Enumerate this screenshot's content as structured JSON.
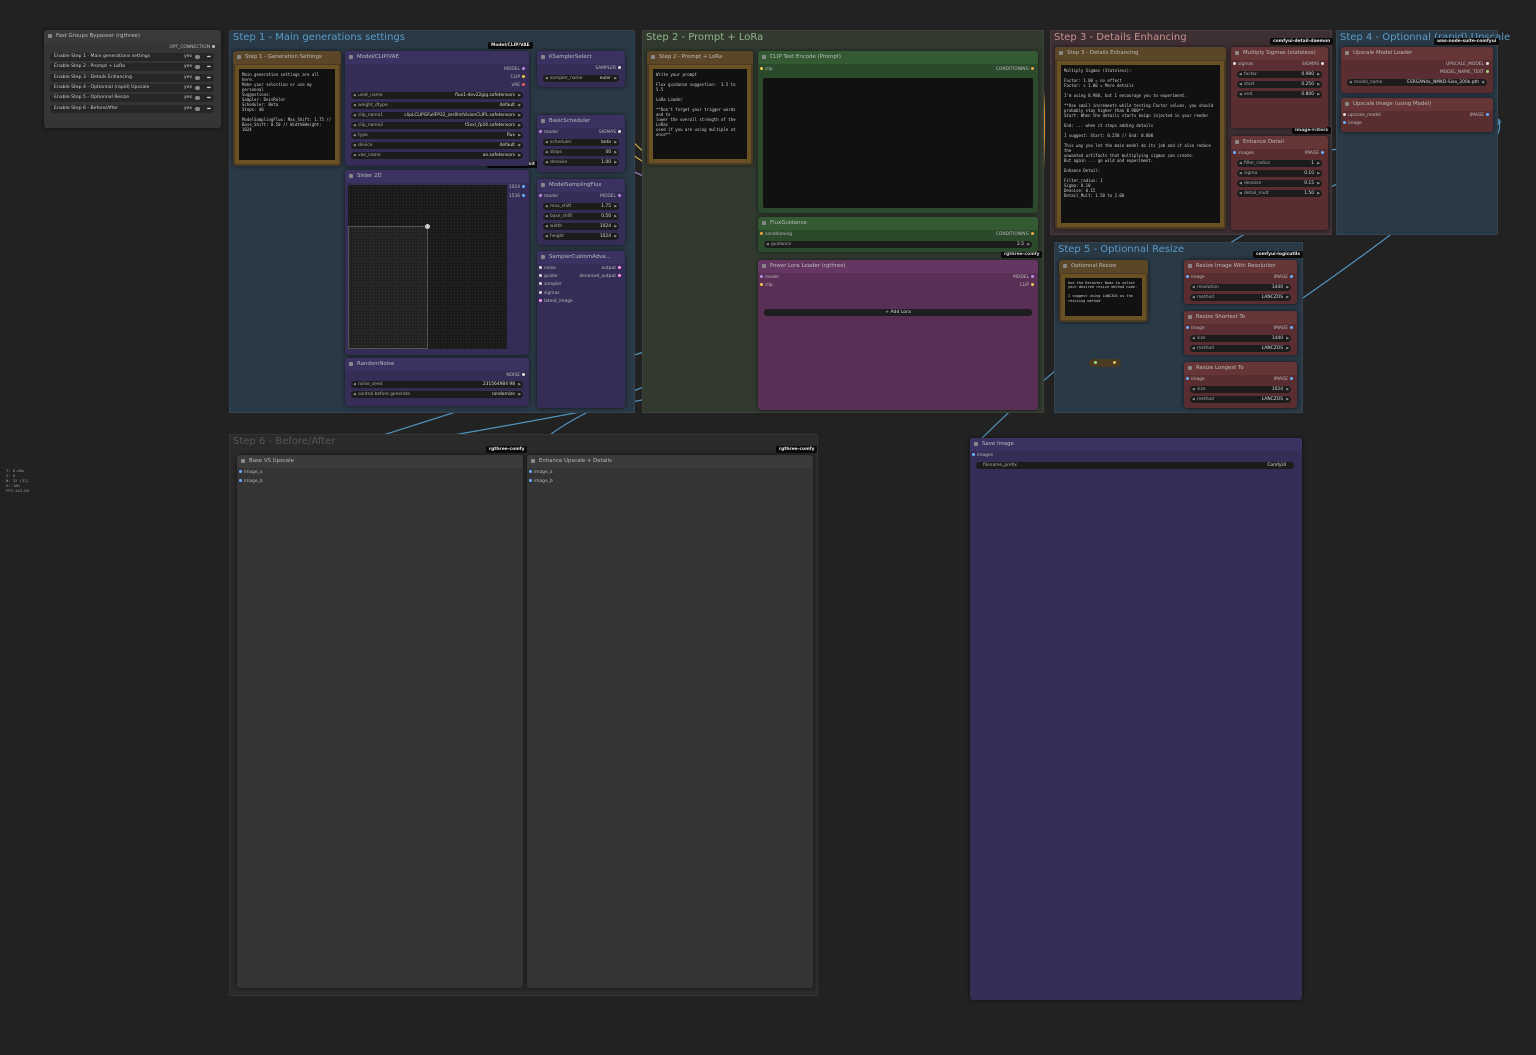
{
  "bypasser": {
    "title": "Fast Groups Bypasser (rgthree)",
    "output": "OPT_CONNECTION",
    "rows": [
      {
        "label": "Enable Step 1 - Main generations settings",
        "value": "yes"
      },
      {
        "label": "Enable Step 2 - Prompt + LoRa",
        "value": "yes"
      },
      {
        "label": "Enable Step 3 - Details Enhancing",
        "value": "yes"
      },
      {
        "label": "Enable Step 4 - Optionnal (rapid) Upscale",
        "value": "yes"
      },
      {
        "label": "Enable Step 5 - Optionnal Resize",
        "value": "yes"
      },
      {
        "label": "Enable Step 6 - Before/After",
        "value": "yes"
      }
    ]
  },
  "stats": [
    "T: 0.00s",
    "I: 0",
    "N: 32 [32]",
    "V: 100",
    "FPS:142.86"
  ],
  "groups": {
    "step1": "Step 1 - Main generations settings",
    "step2": "Step 2 - Prompt + LoRa",
    "step3": "Step 3 - Details Enhancing",
    "step4": "Step 4 - Optionnal (rapid) Upscale",
    "step5": "Step 5 - Optionnal Resize",
    "step6": "Step 6 - Before/After"
  },
  "badges": {
    "modelclip": "Model/CLIP/VAE",
    "mxtoolkit": "comfyui-mxtoolkit",
    "rgthree1": "rgthree-comfy",
    "detaildaemon": "comfyui-detail-daemon",
    "wasnode": "was-node-suite-comfyui",
    "imagefilters": "Image-Filters",
    "logicutils": "comfyui-logicutils",
    "rgthree2": "rgthree-comfy",
    "rgthree3": "rgthree-comfy"
  },
  "step1_settings": {
    "title": "Step 1 - Generation Settings",
    "text": "Main generation settings are all here.\nMake your selection or use my personnal\nSuggestions:\nSampler: DeisRelor\nScheduler: Beta\nSteps: 40\n\nModelSamplingFlux: Max_Shift: 1.75 //\nBase_Shift: 0.50 // Width&Height: 1024"
  },
  "model_loader": {
    "title": "Model/CLIP/VAE",
    "outputs": [
      "MODEL",
      "CLIP",
      "VAE"
    ],
    "widgets": [
      {
        "label": "unet_name",
        "value": "flux1-dev22gig.safetensors"
      },
      {
        "label": "weight_dtype",
        "value": "default"
      },
      {
        "label": "clip_name1",
        "value": "clipLCLIPGFullFP32_zer0IntVisionCLIPL.safetensors"
      },
      {
        "label": "clip_name2",
        "value": "t5xxl_fp16.safetensors"
      },
      {
        "label": "type",
        "value": "flux"
      },
      {
        "label": "device",
        "value": "default"
      },
      {
        "label": "vae_name",
        "value": "ae.safetensors"
      }
    ]
  },
  "slider2d": {
    "title": "Slider 2D",
    "out1": "1024",
    "out2": "1536"
  },
  "random_noise": {
    "title": "RandomNoise",
    "output": "NOISE",
    "widgets": [
      {
        "label": "noise_seed",
        "value": "231564984 98"
      },
      {
        "label": "control before generate",
        "value": "randomize"
      }
    ]
  },
  "ksampler_select": {
    "title": "KSamplerSelect",
    "output": "SAMPLER",
    "widgets": [
      {
        "label": "sampler_name",
        "value": "euler"
      }
    ]
  },
  "basic_scheduler": {
    "title": "BasicScheduler",
    "input": "model",
    "output": "SIGMAS",
    "widgets": [
      {
        "label": "scheduler",
        "value": "beta"
      },
      {
        "label": "steps",
        "value": "40"
      },
      {
        "label": "denoise",
        "value": "1.00"
      }
    ]
  },
  "model_sampling_flux": {
    "title": "ModelSamplingFlux",
    "input": "model",
    "output": "MODEL",
    "widgets": [
      {
        "label": "max_shift",
        "value": "1.75"
      },
      {
        "label": "base_shift",
        "value": "0.50"
      },
      {
        "label": "width",
        "value": "1024"
      },
      {
        "label": "height",
        "value": "1024"
      }
    ]
  },
  "sampler_custom": {
    "title": "SamplerCustomAdva...",
    "inputs": [
      "noise",
      "guider",
      "sampler",
      "sigmas",
      "latent_image"
    ],
    "outputs": [
      "output",
      "denoised_output"
    ]
  },
  "step2_note": {
    "title": "Step 2 - Prompt + LoRa",
    "text": "Write your prompt\n\nFlux guidance suggestion:  3.5 to 5.5\n\nLoRa Loader\n\n**Don't forget your trigger words and to\nlower the overall strength of the LoRas\nused if you are using multiple at once**"
  },
  "clip_text": {
    "title": "CLIP Text Encode (Prompt)",
    "input": "clip",
    "output": "CONDITIONING"
  },
  "flux_guidance": {
    "title": "FluxGuidance",
    "input": "conditioning",
    "output": "CONDITIONING",
    "widgets": [
      {
        "label": "guidance",
        "value": "2.5"
      }
    ]
  },
  "power_lora": {
    "title": "Power Lora Loader (rgthree)",
    "inputs": [
      "model",
      "clip"
    ],
    "outputs": [
      "MODEL",
      "CLIP"
    ],
    "button": "Add Lora"
  },
  "step3_note": {
    "title": "Step 3 - Details Enhancing",
    "text": "Multiply Sigmas (Stateless):\n\nFactor: 1.00 = no effect\nFactor: < 1.00 = More details\n\nI'm using 0.980, but I encourage you to experiment.\n\n**Use small increments while testing Factor values, you should\nprobably stay higher than 0.960**\nStart: When the details starts beign injected in your render\n\nEnd: ... when it stops adding details\n\nI suggest: Start: 0.250 // End: 0.800\n\nThis way you let the main model do its job and it also reduce the\nunwanted artifacts that multiplying sigmas can create.\nBut again ... go wild and experiment.\n\nEnhance Detail:\n\nFilter_radius: 1\nSigma: 0.10\nDenoise: 0.15\nDetail_Mult: 1.50 to 2.00"
  },
  "multiply_sigmas": {
    "title": "Multiply Sigmas (stateless)",
    "input": "sigmas",
    "output": "SIGMAS",
    "widgets": [
      {
        "label": "factor",
        "value": "0.980"
      },
      {
        "label": "start",
        "value": "0.250"
      },
      {
        "label": "end",
        "value": "0.800"
      }
    ]
  },
  "enhance_detail": {
    "title": "Enhance Detail",
    "input": "images",
    "output": "IMAGE",
    "widgets": [
      {
        "label": "filter_radius",
        "value": "1"
      },
      {
        "label": "sigma",
        "value": "0.10"
      },
      {
        "label": "denoise",
        "value": "0.15"
      },
      {
        "label": "detail_mult",
        "value": "1.50"
      }
    ]
  },
  "upscale_loader": {
    "title": "Upscale Model Loader",
    "outputs": [
      "UPSCALE_MODEL",
      "MODEL_NAME_TEXT"
    ],
    "widgets": [
      {
        "label": "model_name",
        "value": "ESRGAN4x_NMKD-Siax_200k.pth"
      }
    ]
  },
  "upscale_image": {
    "title": "Upscale Image (using Model)",
    "inputs": [
      "upscale_model",
      "image"
    ],
    "output": "IMAGE"
  },
  "optional_resize": {
    "title": "Optionnal Resize",
    "text": "Use the Rerouter Node to select\nyour desired resize method node.\n\nI suggest using LANCZOS as the\nresizing method"
  },
  "resize_resolution": {
    "title": "Resize Image With Resolution",
    "input": "image",
    "output": "IMAGE",
    "widgets": [
      {
        "label": "resolution",
        "value": "1440"
      },
      {
        "label": "method",
        "value": "LANCZOS"
      }
    ]
  },
  "resize_shortest": {
    "title": "Resize Shortest To",
    "input": "image",
    "output": "IMAGE",
    "widgets": [
      {
        "label": "size",
        "value": "1440"
      },
      {
        "label": "method",
        "value": "LANCZOS"
      }
    ]
  },
  "resize_longest": {
    "title": "Resize Longest To",
    "input": "image",
    "output": "IMAGE",
    "widgets": [
      {
        "label": "size",
        "value": "1024"
      },
      {
        "label": "method",
        "value": "LANCZOS"
      }
    ]
  },
  "compare1": {
    "title": "Base VS Upscale",
    "inputs": [
      "image_a",
      "image_b"
    ]
  },
  "compare2": {
    "title": "Enhance Upscale + Details",
    "inputs": [
      "image_a",
      "image_b"
    ]
  },
  "save_image": {
    "title": "Save Image",
    "input": "images",
    "widgets": [
      {
        "label": "filename_prefix",
        "value": "ComfyUI"
      }
    ]
  },
  "colors": {
    "background": "#222222",
    "group_blue": "#2a3946",
    "group_green": "#323a30",
    "group_red": "#3e2f33",
    "link_yellow": "#e8c84a",
    "link_blue": "#5aa7d9",
    "link_purple": "#b98fe0"
  }
}
